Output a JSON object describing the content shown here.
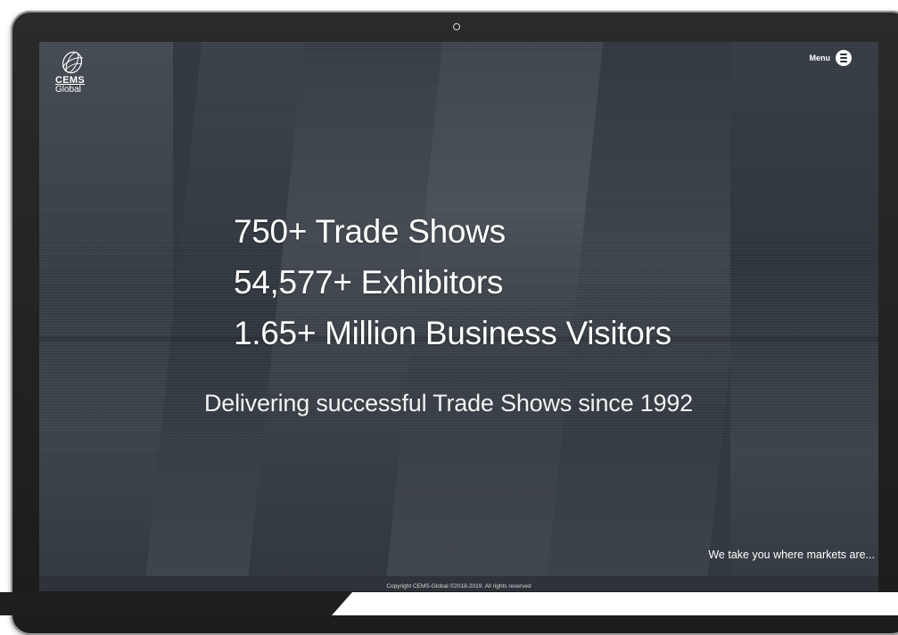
{
  "logo": {
    "icon": "globe-swirl-icon",
    "name": "CEMS",
    "sub": "Global"
  },
  "menu": {
    "label": "Menu",
    "icon": "hamburger-circle-icon"
  },
  "hero": {
    "stats": [
      "750+ Trade Shows",
      "54,577+ Exhibitors",
      "1.65+ Million Business Visitors"
    ],
    "tagline": "Delivering successful Trade Shows since 1992",
    "slogan": "We take you where markets are..."
  },
  "footer": {
    "copyright": "Copyright CEMS-Global ©2018-2019. All rights reserved"
  },
  "colors": {
    "frame": "#1c1c1c",
    "overlay": "#282e36",
    "text": "#ffffff",
    "footer": "#2e333a"
  }
}
